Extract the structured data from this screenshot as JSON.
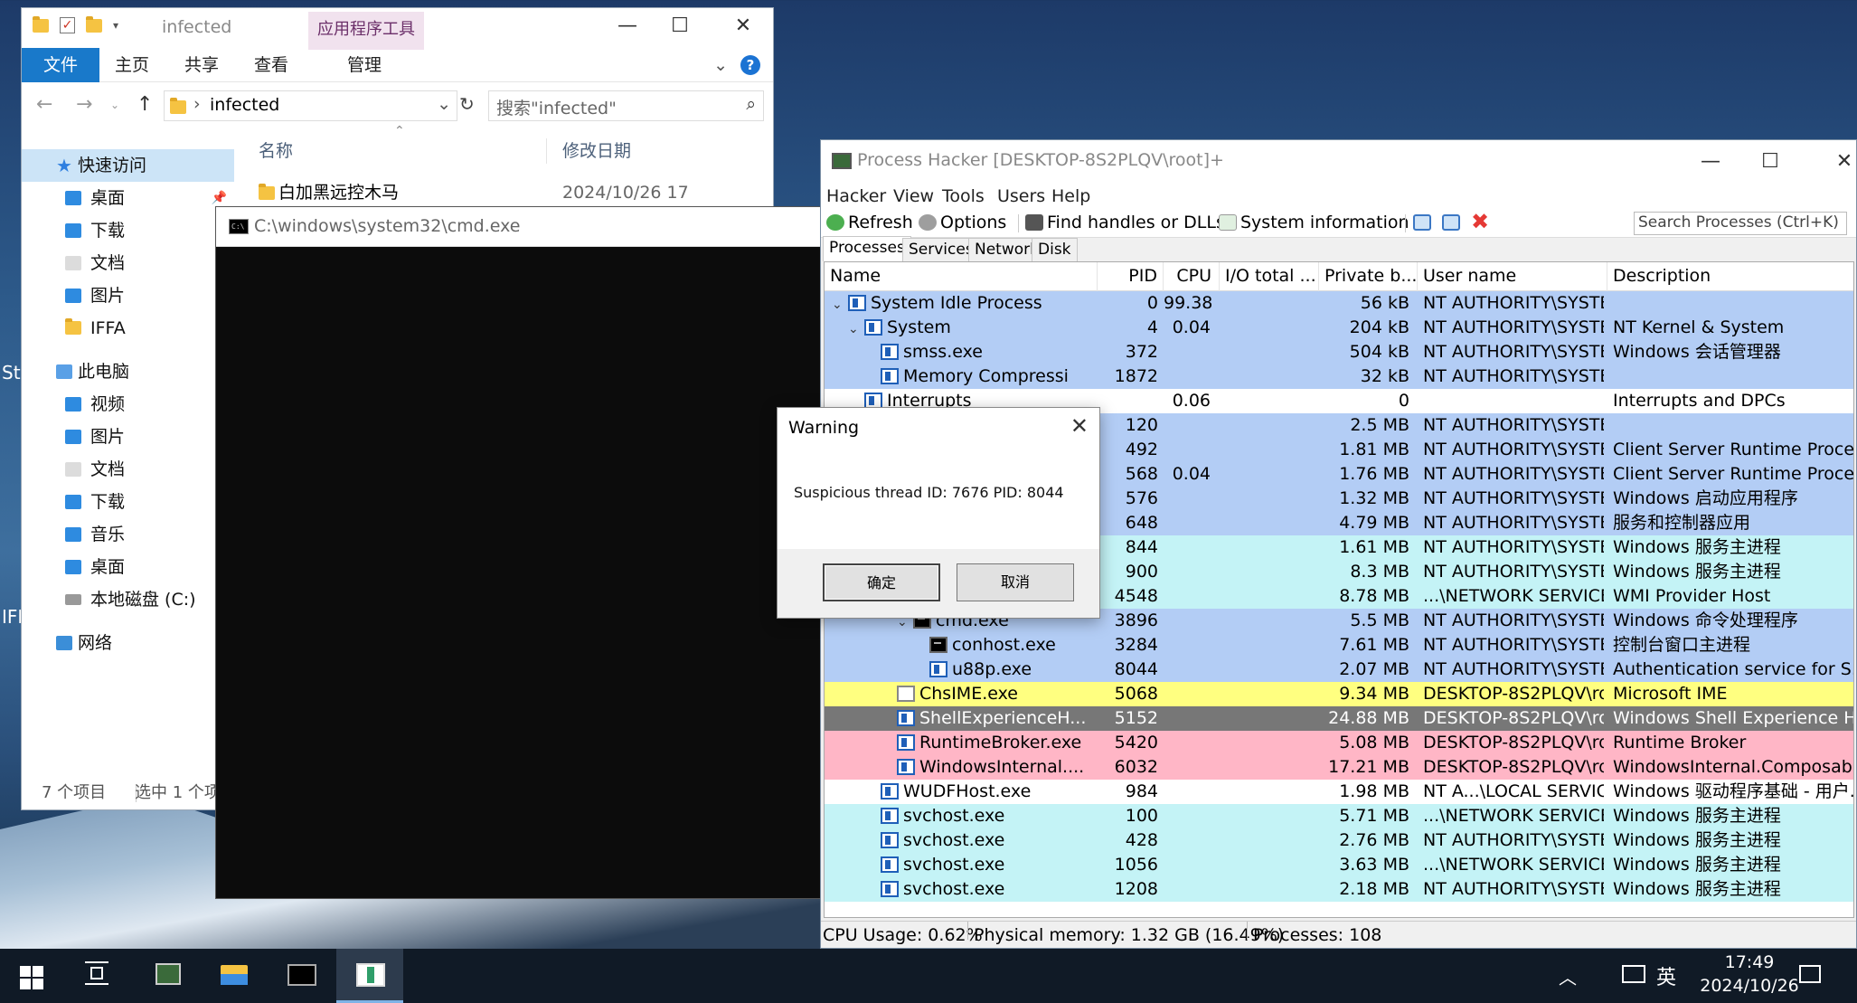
{
  "desktop": {
    "peek_labels": [
      "St",
      "IFF"
    ]
  },
  "explorer": {
    "title": "infected",
    "app_tools_tab": "应用程序工具",
    "ribbon_tabs": [
      "文件",
      "主页",
      "共享",
      "查看",
      "管理"
    ],
    "help": "?",
    "address": "infected",
    "search_placeholder": "搜索\"infected\"",
    "nav": {
      "quick_access": "快速访问",
      "qa_items": [
        "桌面",
        "下载",
        "文档",
        "图片",
        "IFFA"
      ],
      "this_pc": "此电脑",
      "pc_items": [
        "视频",
        "图片",
        "文档",
        "下载",
        "音乐",
        "桌面",
        "本地磁盘 (C:)"
      ],
      "network": "网络"
    },
    "columns": {
      "name": "名称",
      "modified": "修改日期"
    },
    "file_row": {
      "name": "白加黑远控木马",
      "modified": "2024/10/26 17"
    },
    "status": {
      "count": "7 个项目",
      "selected": "选中 1 个项"
    }
  },
  "cmd": {
    "title": "C:\\windows\\system32\\cmd.exe",
    "icon_text": "C:\\"
  },
  "process_hacker": {
    "title": "Process Hacker [DESKTOP-8S2PLQV\\root]+",
    "menu": [
      "Hacker",
      "View",
      "Tools",
      "Users",
      "Help"
    ],
    "toolbar": {
      "refresh": "Refresh",
      "options": "Options",
      "find": "Find handles or DLLs",
      "sysinfo": "System information",
      "search_placeholder": "Search Processes (Ctrl+K)"
    },
    "tabs": [
      "Processes",
      "Services",
      "Network",
      "Disk"
    ],
    "columns": [
      "Name",
      "PID",
      "CPU",
      "I/O total ...",
      "Private b...",
      "User name",
      "Description"
    ],
    "rows": [
      {
        "indent": 0,
        "tw": "⌄",
        "name": "System Idle Process",
        "pid": "0",
        "cpu": "99.38",
        "io": "",
        "priv": "56 kB",
        "user": "NT AUTHORITY\\SYSTEM",
        "desc": "",
        "bg": "#b3cdf5",
        "icon": "proc"
      },
      {
        "indent": 1,
        "tw": "⌄",
        "name": "System",
        "pid": "4",
        "cpu": "0.04",
        "io": "",
        "priv": "204 kB",
        "user": "NT AUTHORITY\\SYSTEM",
        "desc": "NT Kernel & System",
        "bg": "#b3cdf5",
        "icon": "proc"
      },
      {
        "indent": 2,
        "tw": "",
        "name": "smss.exe",
        "pid": "372",
        "cpu": "",
        "io": "",
        "priv": "504 kB",
        "user": "NT AUTHORITY\\SYSTEM",
        "desc": "Windows 会话管理器",
        "bg": "#b3cdf5",
        "icon": "proc"
      },
      {
        "indent": 2,
        "tw": "",
        "name": "Memory Compressi",
        "pid": "1872",
        "cpu": "",
        "io": "",
        "priv": "32 kB",
        "user": "NT AUTHORITY\\SYSTEM",
        "desc": "",
        "bg": "#b3cdf5",
        "icon": "proc"
      },
      {
        "indent": 1,
        "tw": "",
        "name": "Interrupts",
        "pid": "",
        "cpu": "0.06",
        "io": "",
        "priv": "0",
        "user": "",
        "desc": "Interrupts and DPCs",
        "bg": "#ffffff",
        "icon": "proc"
      },
      {
        "indent": 0,
        "tw": "",
        "name": "",
        "pid": "120",
        "cpu": "",
        "io": "",
        "priv": "2.5 MB",
        "user": "NT AUTHORITY\\SYSTEM",
        "desc": "",
        "bg": "#b3cdf5",
        "icon": "none"
      },
      {
        "indent": 0,
        "tw": "",
        "name": "",
        "pid": "492",
        "cpu": "",
        "io": "",
        "priv": "1.81 MB",
        "user": "NT AUTHORITY\\SYSTEM",
        "desc": "Client Server Runtime Process",
        "bg": "#b3cdf5",
        "icon": "none"
      },
      {
        "indent": 0,
        "tw": "",
        "name": "",
        "pid": "568",
        "cpu": "0.04",
        "io": "",
        "priv": "1.76 MB",
        "user": "NT AUTHORITY\\SYSTEM",
        "desc": "Client Server Runtime Process",
        "bg": "#b3cdf5",
        "icon": "none"
      },
      {
        "indent": 0,
        "tw": "",
        "name": "",
        "pid": "576",
        "cpu": "",
        "io": "",
        "priv": "1.32 MB",
        "user": "NT AUTHORITY\\SYSTEM",
        "desc": "Windows 启动应用程序",
        "bg": "#b3cdf5",
        "icon": "none"
      },
      {
        "indent": 0,
        "tw": "",
        "name": "",
        "pid": "648",
        "cpu": "",
        "io": "",
        "priv": "4.79 MB",
        "user": "NT AUTHORITY\\SYSTEM",
        "desc": "服务和控制器应用",
        "bg": "#b3cdf5",
        "icon": "none"
      },
      {
        "indent": 0,
        "tw": "",
        "name": "",
        "pid": "844",
        "cpu": "",
        "io": "",
        "priv": "1.61 MB",
        "user": "NT AUTHORITY\\SYSTEM",
        "desc": "Windows 服务主进程",
        "bg": "#c4f3f6",
        "icon": "none"
      },
      {
        "indent": 0,
        "tw": "",
        "name": "",
        "pid": "900",
        "cpu": "",
        "io": "",
        "priv": "8.3 MB",
        "user": "NT AUTHORITY\\SYSTEM",
        "desc": "Windows 服务主进程",
        "bg": "#c4f3f6",
        "icon": "none"
      },
      {
        "indent": 0,
        "tw": "",
        "name": "",
        "pid": "4548",
        "cpu": "",
        "io": "",
        "priv": "8.78 MB",
        "user": "...\\NETWORK SERVICE",
        "desc": "WMI Provider Host",
        "bg": "#c4f3f6",
        "icon": "none"
      },
      {
        "indent": 4,
        "tw": "⌄",
        "name": "cmd.exe",
        "pid": "3896",
        "cpu": "",
        "io": "",
        "priv": "5.5 MB",
        "user": "NT AUTHORITY\\SYSTEM",
        "desc": "Windows 命令处理程序",
        "bg": "#b3cdf5",
        "icon": "cmd"
      },
      {
        "indent": 5,
        "tw": "",
        "name": "conhost.exe",
        "pid": "3284",
        "cpu": "",
        "io": "",
        "priv": "7.61 MB",
        "user": "NT AUTHORITY\\SYSTEM",
        "desc": "控制台窗口主进程",
        "bg": "#b3cdf5",
        "icon": "cmd"
      },
      {
        "indent": 5,
        "tw": "",
        "name": "u88p.exe",
        "pid": "8044",
        "cpu": "",
        "io": "",
        "priv": "2.07 MB",
        "user": "NT AUTHORITY\\SYSTEM",
        "desc": "Authentication service for S...",
        "bg": "#b3cdf5",
        "icon": "proc"
      },
      {
        "indent": 3,
        "tw": "",
        "name": "ChsIME.exe",
        "pid": "5068",
        "cpu": "",
        "io": "",
        "priv": "9.34 MB",
        "user": "DESKTOP-8S2PLQV\\root",
        "desc": "Microsoft IME",
        "bg": "#ffff80",
        "icon": "ime"
      },
      {
        "indent": 3,
        "tw": "",
        "name": "ShellExperienceH...",
        "pid": "5152",
        "cpu": "",
        "io": "",
        "priv": "24.88 MB",
        "user": "DESKTOP-8S2PLQV\\root",
        "desc": "Windows Shell Experience H",
        "bg": "#777777",
        "icon": "proc"
      },
      {
        "indent": 3,
        "tw": "",
        "name": "RuntimeBroker.exe",
        "pid": "5420",
        "cpu": "",
        "io": "",
        "priv": "5.08 MB",
        "user": "DESKTOP-8S2PLQV\\root",
        "desc": "Runtime Broker",
        "bg": "#ffb6c6",
        "icon": "proc"
      },
      {
        "indent": 3,
        "tw": "",
        "name": "WindowsInternal....",
        "pid": "6032",
        "cpu": "",
        "io": "",
        "priv": "17.21 MB",
        "user": "DESKTOP-8S2PLQV\\root",
        "desc": "WindowsInternal.Composab...",
        "bg": "#ffb6c6",
        "icon": "proc"
      },
      {
        "indent": 2,
        "tw": "",
        "name": "WUDFHost.exe",
        "pid": "984",
        "cpu": "",
        "io": "",
        "priv": "1.98 MB",
        "user": "NT A...\\LOCAL SERVICE",
        "desc": "Windows 驱动程序基础 - 用户...",
        "bg": "#ffffff",
        "icon": "proc"
      },
      {
        "indent": 2,
        "tw": "",
        "name": "svchost.exe",
        "pid": "100",
        "cpu": "",
        "io": "",
        "priv": "5.71 MB",
        "user": "...\\NETWORK SERVICE",
        "desc": "Windows 服务主进程",
        "bg": "#c4f3f6",
        "icon": "proc"
      },
      {
        "indent": 2,
        "tw": "",
        "name": "svchost.exe",
        "pid": "428",
        "cpu": "",
        "io": "",
        "priv": "2.76 MB",
        "user": "NT AUTHORITY\\SYSTEM",
        "desc": "Windows 服务主进程",
        "bg": "#c4f3f6",
        "icon": "proc"
      },
      {
        "indent": 2,
        "tw": "",
        "name": "svchost.exe",
        "pid": "1056",
        "cpu": "",
        "io": "",
        "priv": "3.63 MB",
        "user": "...\\NETWORK SERVICE",
        "desc": "Windows 服务主进程",
        "bg": "#c4f3f6",
        "icon": "proc"
      },
      {
        "indent": 2,
        "tw": "",
        "name": "svchost.exe",
        "pid": "1208",
        "cpu": "",
        "io": "",
        "priv": "2.18 MB",
        "user": "NT AUTHORITY\\SYSTEM",
        "desc": "Windows 服务主进程",
        "bg": "#c4f3f6",
        "icon": "proc"
      }
    ],
    "status": {
      "cpu": "CPU Usage: 0.62%",
      "memory": "Physical memory: 1.32 GB (16.49%)",
      "processes": "Processes: 108"
    }
  },
  "dialog": {
    "title": "Warning",
    "message": "Suspicious thread ID: 7676 PID: 8044",
    "ok": "确定",
    "cancel": "取消"
  },
  "taskbar": {
    "ime": "英",
    "time": "17:49",
    "date": "2024/10/26"
  },
  "colors": {
    "explorer_accent": "#1979ca",
    "service_blue": "#b3cdf5",
    "service_cyan": "#c4f3f6",
    "own_process_yellow": "#ffff80",
    "suspended_gray": "#777777",
    "immersive_pink": "#ffb6c6"
  }
}
